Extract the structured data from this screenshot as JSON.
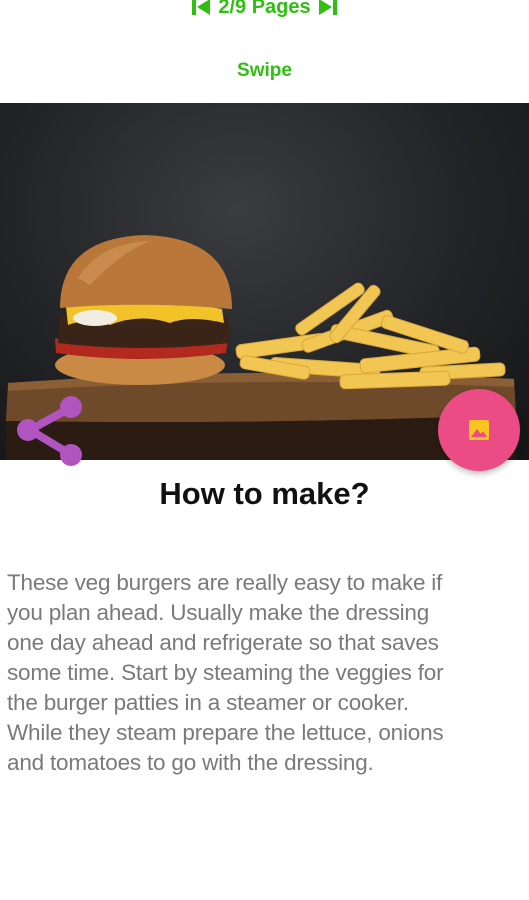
{
  "pager": {
    "first_icon": "skip-previous-icon",
    "label": "2/9 Pages",
    "last_icon": "skip-next-icon"
  },
  "swipe_label": "Swipe",
  "hero_image": {
    "subject": "burger-and-fries-photo"
  },
  "share_icon": "share-icon",
  "fab_icon": "image-icon",
  "colors": {
    "accent_green": "#2fbf10",
    "share_purple": "#b054c0",
    "fab_pink": "#ec4c85",
    "fab_icon_yellow": "#f7c51e"
  },
  "article": {
    "title": "How to make?",
    "body": "These veg burgers are really easy to make if\nyou plan ahead. Usually make the dressing\none day ahead and refrigerate so that saves\nsome time. Start by steaming the veggies for\nthe burger patties in a steamer or cooker.\nWhile they steam  prepare the lettuce, onions\nand tomatoes to go with the dressing."
  }
}
